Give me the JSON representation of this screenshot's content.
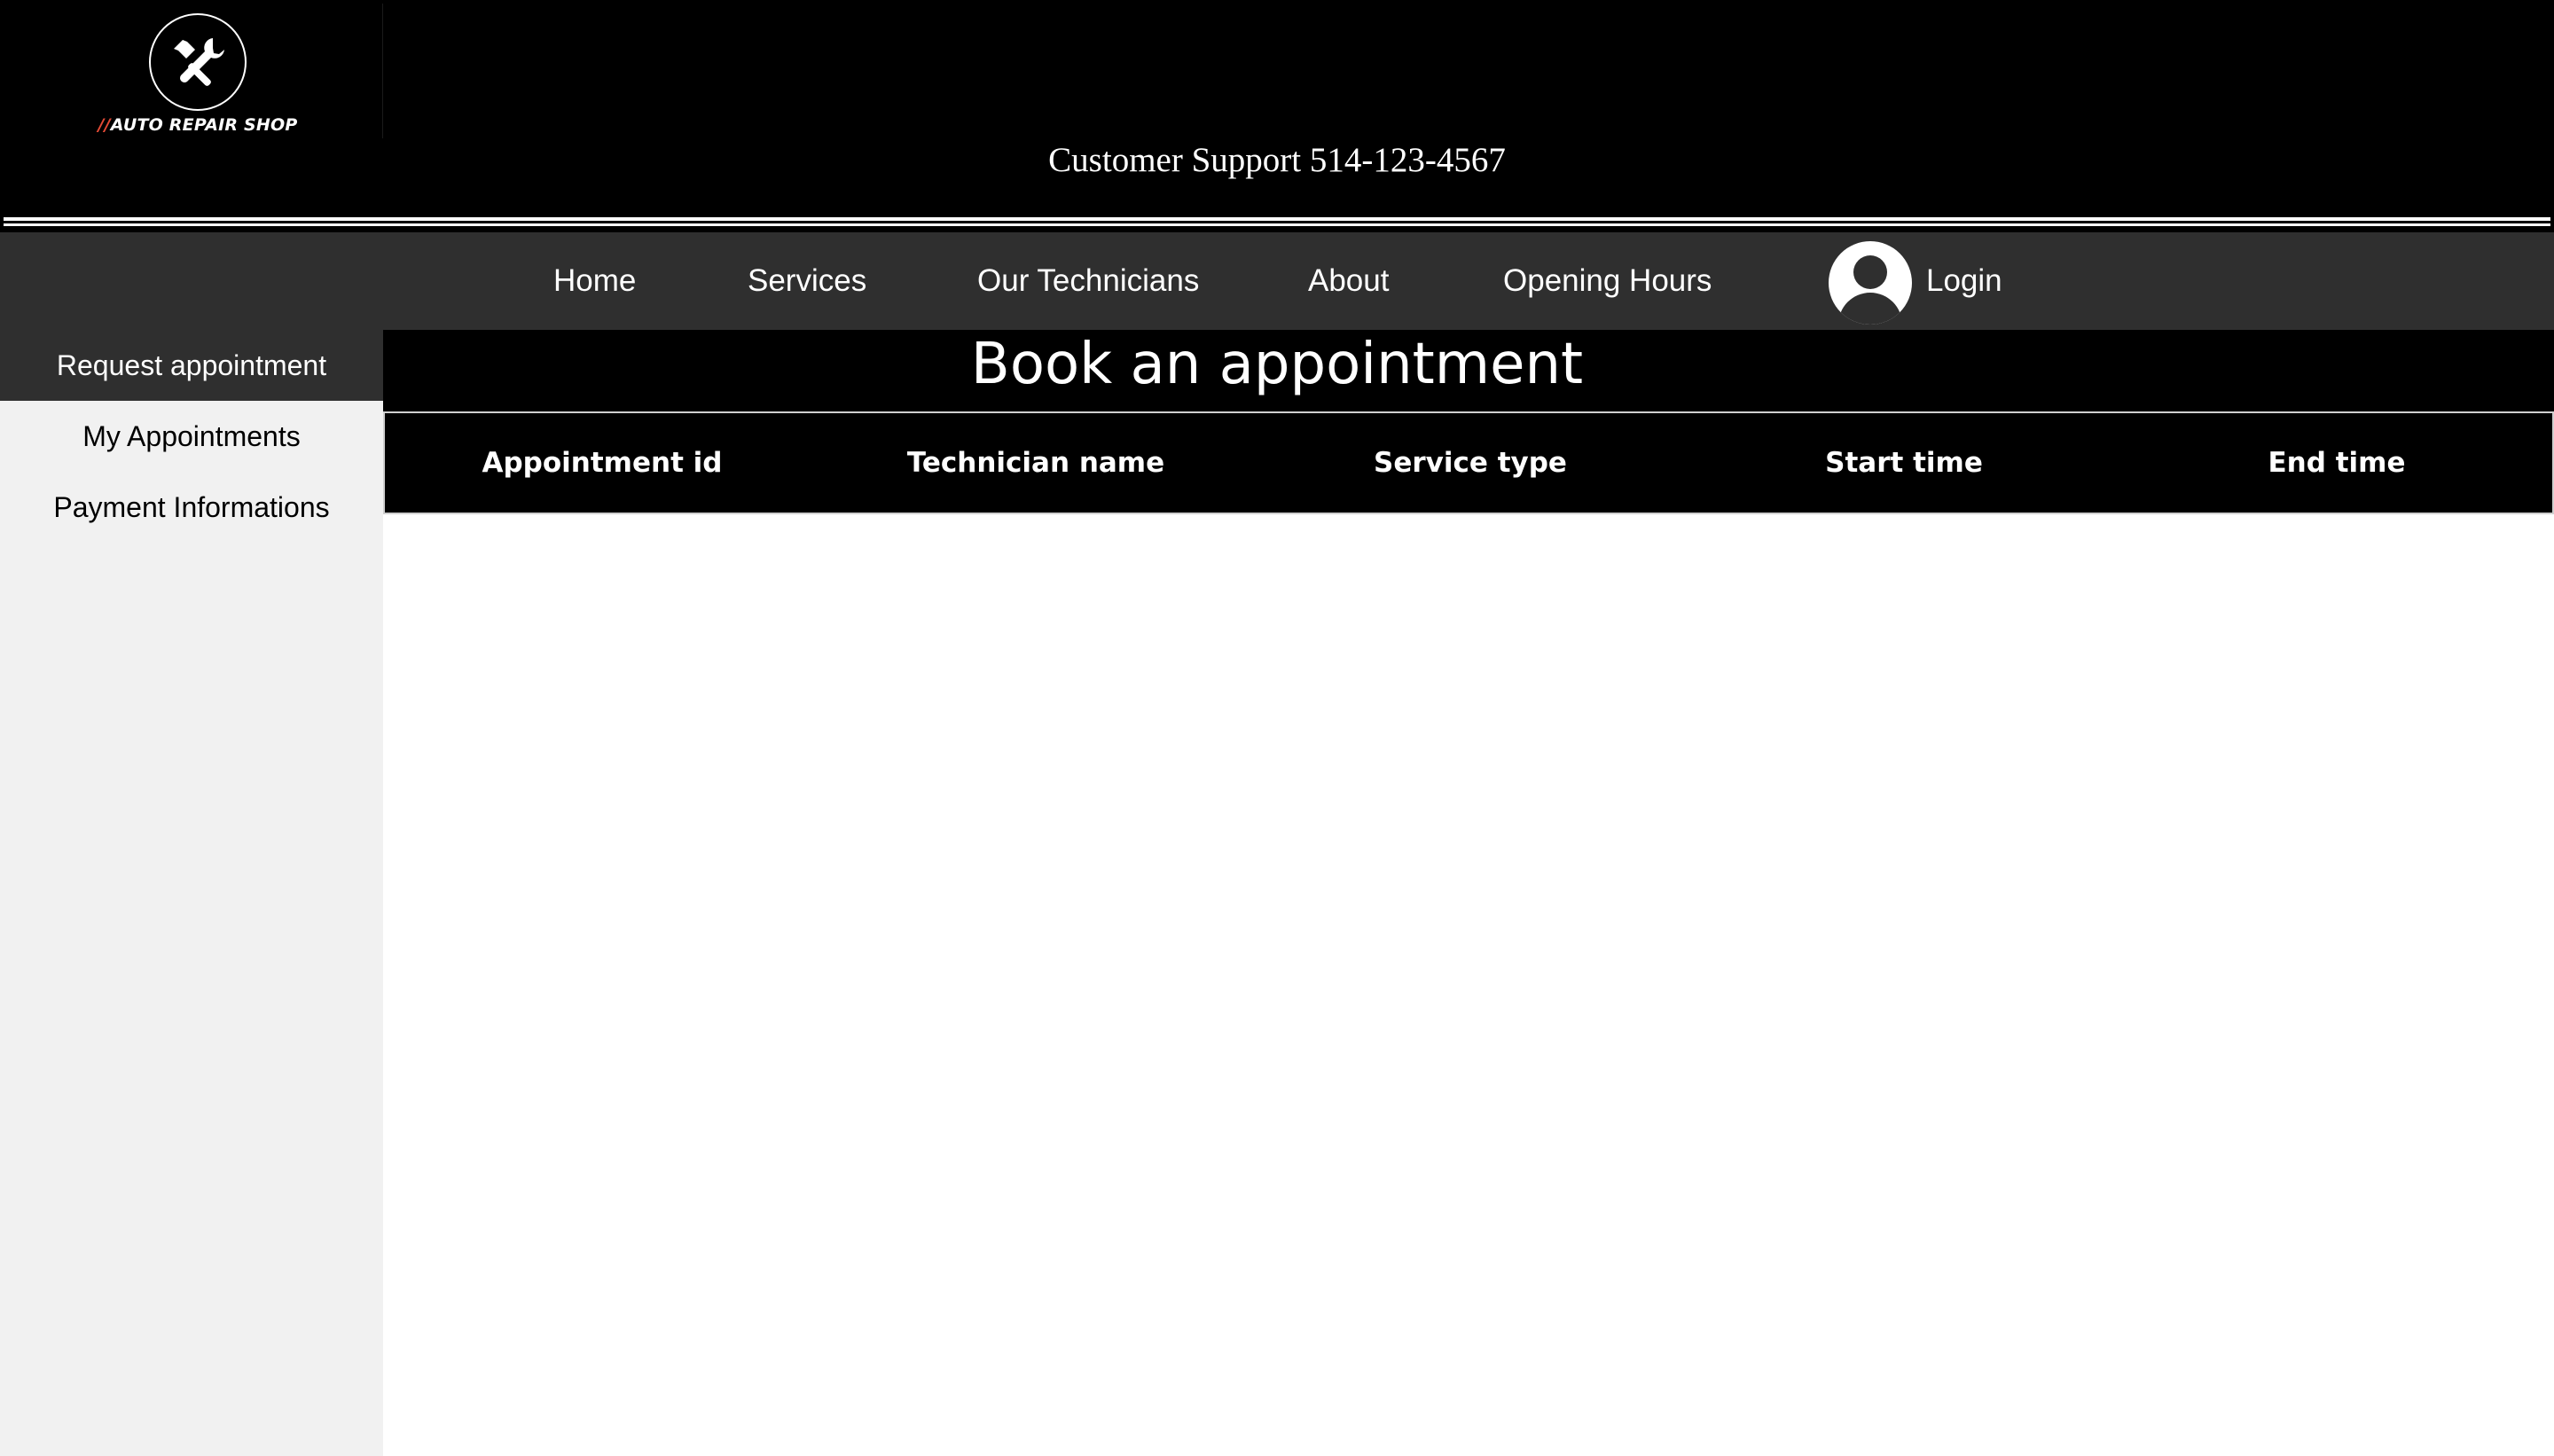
{
  "header": {
    "logo": {
      "icon": "hammer-wrench-icon",
      "slashes": "//",
      "text": "AUTO REPAIR SHOP"
    },
    "support": "Customer Support 514-123-4567"
  },
  "nav": {
    "items": [
      {
        "label": "Home"
      },
      {
        "label": "Services"
      },
      {
        "label": "Our Technicians"
      },
      {
        "label": "About"
      },
      {
        "label": "Opening Hours"
      }
    ],
    "login": {
      "icon": "user-avatar-icon",
      "label": "Login"
    }
  },
  "sidebar": {
    "items": [
      {
        "label": "Request appointment",
        "active": true
      },
      {
        "label": "My Appointments",
        "active": false
      },
      {
        "label": "Payment Informations",
        "active": false
      }
    ]
  },
  "main": {
    "title": "Book an appointment",
    "table": {
      "columns": [
        "Appointment id",
        "Technician name",
        "Service type",
        "Start time",
        "End time"
      ],
      "rows": []
    }
  },
  "colors": {
    "header_bg": "#000000",
    "nav_bg": "#2f2f2f",
    "sidebar_bg": "#f1f1f1",
    "accent": "#e34a35"
  }
}
